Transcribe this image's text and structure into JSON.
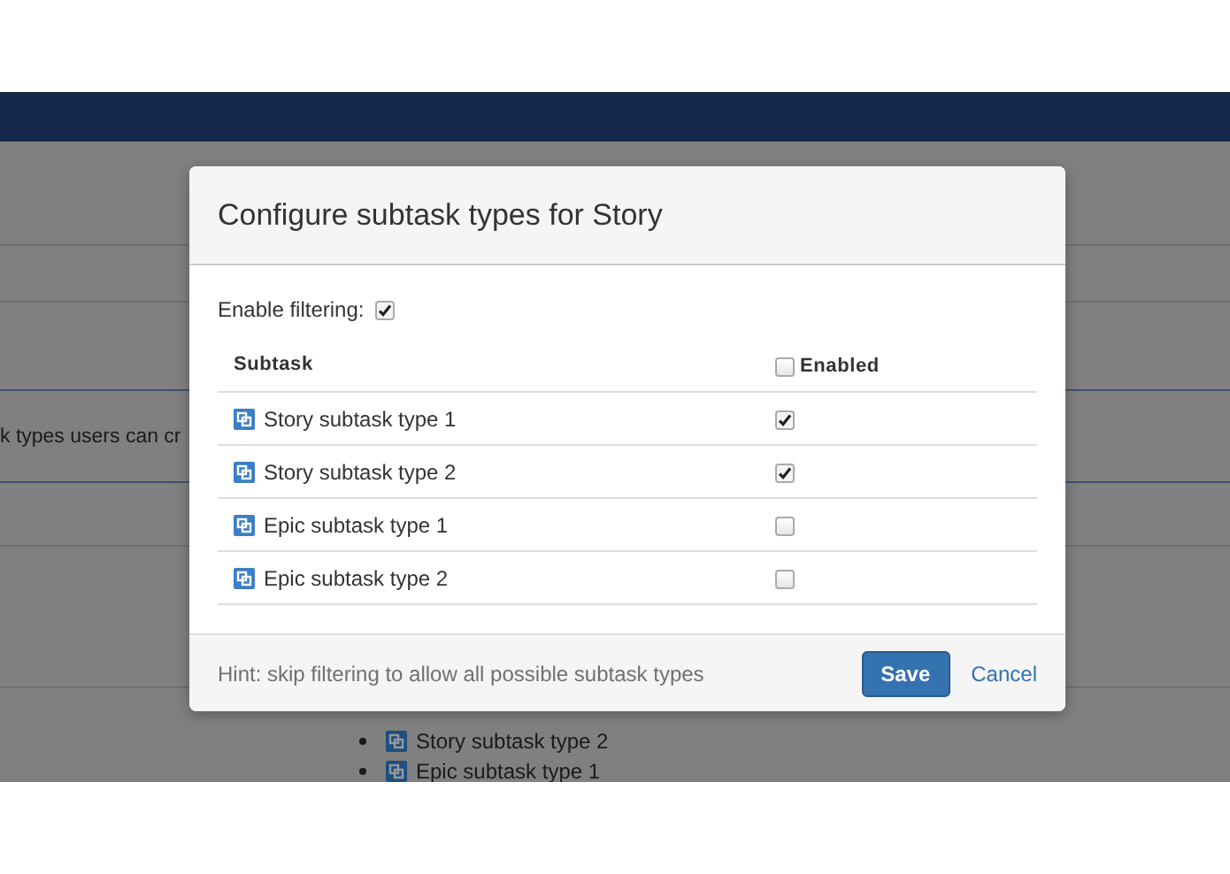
{
  "background": {
    "description_fragment": "k types users can cr",
    "subtask_list": [
      {
        "name": "Story subtask type 2"
      },
      {
        "name": "Epic subtask type 1"
      }
    ]
  },
  "dialog": {
    "title": "Configure subtask types for Story",
    "filter_label": "Enable filtering:",
    "filter_enabled": true,
    "columns": [
      "Subtask",
      "Enabled"
    ],
    "select_all_checked": false,
    "rows": [
      {
        "name": "Story subtask type 1",
        "enabled": true
      },
      {
        "name": "Story subtask type 2",
        "enabled": true
      },
      {
        "name": "Epic subtask type 1",
        "enabled": false
      },
      {
        "name": "Epic subtask type 2",
        "enabled": false
      }
    ],
    "hint": "Hint: skip filtering to allow all possible subtask types",
    "save": "Save",
    "cancel": "Cancel"
  }
}
